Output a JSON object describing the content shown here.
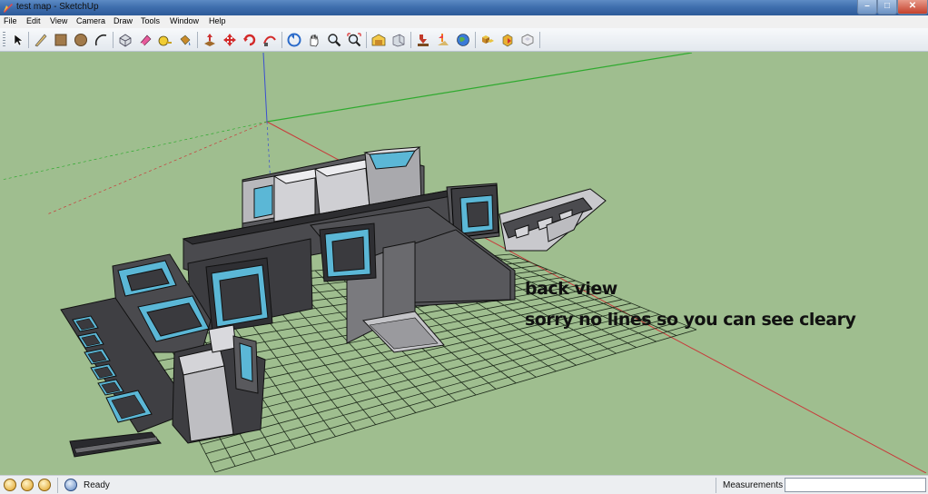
{
  "window": {
    "title": "test map - SketchUp",
    "minimize_glyph": "–",
    "maximize_glyph": "□",
    "close_glyph": "✕"
  },
  "menu": [
    {
      "label": "File"
    },
    {
      "label": "Edit"
    },
    {
      "label": "View"
    },
    {
      "label": "Camera"
    },
    {
      "label": "Draw"
    },
    {
      "label": "Tools"
    },
    {
      "label": "Window"
    },
    {
      "label": "Help"
    }
  ],
  "toolbar": {
    "tools": [
      {
        "name": "select-tool-icon"
      },
      {
        "name": "pencil-line-tool-icon"
      },
      {
        "name": "rectangle-tool-icon"
      },
      {
        "name": "circle-tool-icon"
      },
      {
        "name": "arc-tool-icon"
      },
      {
        "name": "make-component-icon"
      },
      {
        "name": "eraser-tool-icon"
      },
      {
        "name": "tape-measure-icon"
      },
      {
        "name": "paint-bucket-icon"
      },
      {
        "name": "push-pull-icon"
      },
      {
        "name": "move-tool-icon"
      },
      {
        "name": "rotate-tool-icon"
      },
      {
        "name": "follow-me-icon"
      },
      {
        "name": "orbit-tool-icon"
      },
      {
        "name": "pan-tool-icon"
      },
      {
        "name": "zoom-tool-icon"
      },
      {
        "name": "zoom-extents-icon"
      },
      {
        "name": "3d-warehouse-icon"
      },
      {
        "name": "share-model-icon"
      },
      {
        "name": "get-models-icon"
      },
      {
        "name": "add-location-icon"
      },
      {
        "name": "google-earth-icon"
      },
      {
        "name": "components-icon"
      },
      {
        "name": "extension-warehouse-icon"
      },
      {
        "name": "layout-icon"
      }
    ]
  },
  "viewport": {
    "annotation_line1": "back view",
    "annotation_line2": "sorry no lines so you can see cleary",
    "colors": {
      "background": "#9fbe8f",
      "red_axis": "#c83a3a",
      "green_axis": "#2faa2f",
      "blue_axis": "#3a4fd0",
      "panel_cyan": "#5bb7d6",
      "dark_face": "#3b3b3f",
      "light_face": "#c9c9cc"
    }
  },
  "statusbar": {
    "status": "Ready",
    "measurements_label": "Measurements",
    "measurements_value": ""
  }
}
